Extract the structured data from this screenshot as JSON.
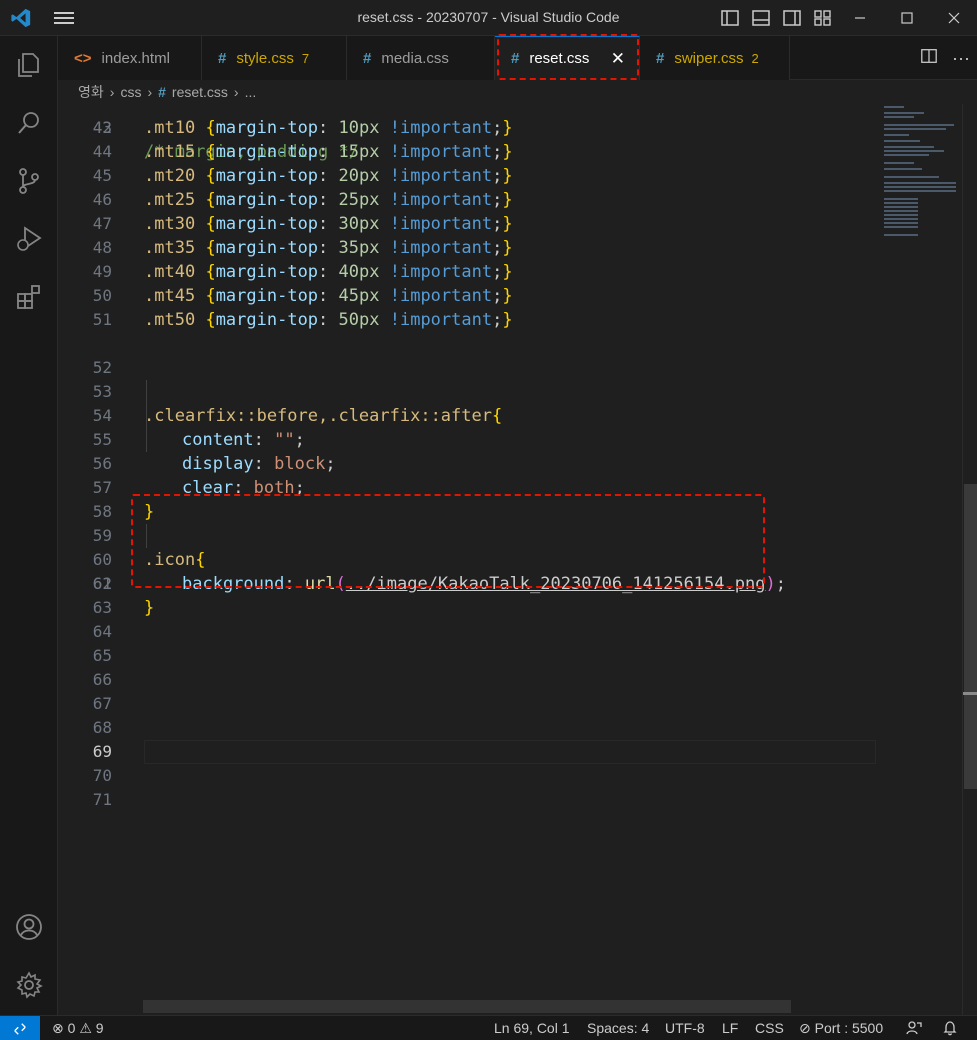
{
  "window": {
    "title": "reset.css - 20230707 - Visual Studio Code"
  },
  "tabs": [
    {
      "label": "index.html",
      "icon": "<>",
      "icon_color": "#e37933",
      "label_color": "#cccccc",
      "count": ""
    },
    {
      "label": "style.css",
      "icon": "#",
      "icon_color": "#519aba",
      "label_color": "#cca700",
      "count": "7"
    },
    {
      "label": "media.css",
      "icon": "#",
      "icon_color": "#519aba",
      "label_color": "#cccccc",
      "count": ""
    },
    {
      "label": "reset.css",
      "icon": "#",
      "icon_color": "#519aba",
      "label_color": "#ffffff",
      "count": "",
      "close": "✕",
      "active": true
    },
    {
      "label": "swiper.css",
      "icon": "#",
      "icon_color": "#519aba",
      "label_color": "#cca700",
      "count": "2"
    }
  ],
  "tab_actions": {
    "split": "split-editor-icon",
    "more": "···"
  },
  "breadcrumb": {
    "folder1": "영화",
    "folder2": "css",
    "file": "reset.css",
    "more": "..."
  },
  "editor": {
    "current_line": "69",
    "line_numbers": [
      "42",
      "43",
      "44",
      "45",
      "46",
      "47",
      "48",
      "49",
      "50",
      "51",
      "52",
      "53",
      "54",
      "55",
      "56",
      "57",
      "58",
      "59",
      "60",
      "61",
      "62",
      "63",
      "64",
      "65",
      "66",
      "67",
      "68",
      "69",
      "70",
      "71"
    ],
    "line42_comment": "/* margin, padding */",
    "margin_rules": [
      {
        "sel": ".mt10",
        "prop": "margin-top",
        "num": "10px",
        "imp": "!important"
      },
      {
        "sel": ".mt15",
        "prop": "margin-top",
        "num": "15px",
        "imp": "!important"
      },
      {
        "sel": ".mt20",
        "prop": "margin-top",
        "num": "20px",
        "imp": "!important"
      },
      {
        "sel": ".mt25",
        "prop": "margin-top",
        "num": "25px",
        "imp": "!important"
      },
      {
        "sel": ".mt30",
        "prop": "margin-top",
        "num": "30px",
        "imp": "!important"
      },
      {
        "sel": ".mt35",
        "prop": "margin-top",
        "num": "35px",
        "imp": "!important"
      },
      {
        "sel": ".mt40",
        "prop": "margin-top",
        "num": "40px",
        "imp": "!important"
      },
      {
        "sel": ".mt45",
        "prop": "margin-top",
        "num": "45px",
        "imp": "!important"
      },
      {
        "sel": ".mt50",
        "prop": "margin-top",
        "num": "50px",
        "imp": "!important"
      }
    ],
    "clearfix": {
      "selector": ".clearfix::before,.clearfix::after",
      "content_prop": "content",
      "content_val": "\"\"",
      "display_prop": "display",
      "display_val": "block",
      "clear_prop": "clear",
      "clear_val": "both"
    },
    "icon_rule": {
      "selector": ".icon",
      "prop": "background",
      "func": "url",
      "path": "../image/KakaoTalk_20230706_141256154.png"
    }
  },
  "status": {
    "errors": "0",
    "warnings": "9",
    "position": "Ln 69, Col 1",
    "spaces": "Spaces: 4",
    "encoding": "UTF-8",
    "eol": "LF",
    "language": "CSS",
    "port": "Port : 5500"
  },
  "colors": {
    "accent": "#0078d4",
    "highlight_box": "#e51400"
  }
}
